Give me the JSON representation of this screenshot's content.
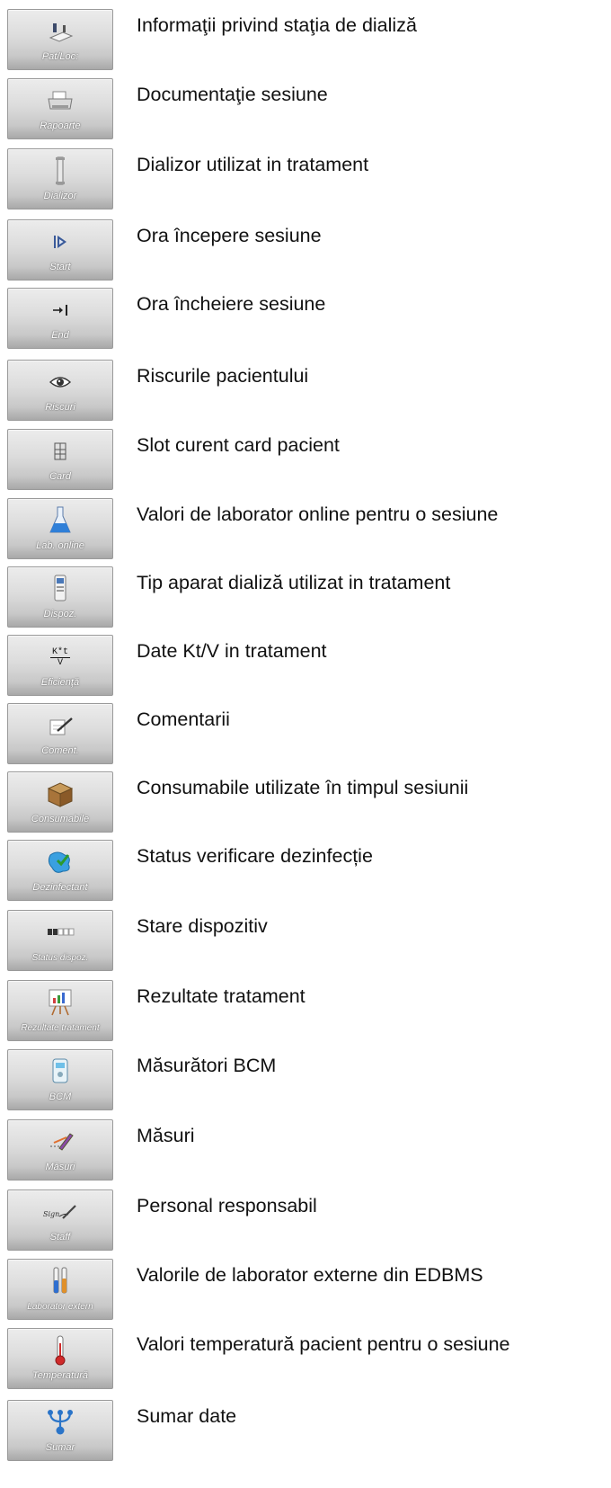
{
  "items": [
    {
      "caption": "Pat/Loc:",
      "icon": "bed-icon",
      "description": "Informaţii privind staţia de dializă"
    },
    {
      "caption": "Rapoarte",
      "icon": "printer-icon",
      "description": "Documentaţie sesiune"
    },
    {
      "caption": "Dializor",
      "icon": "dialyzer-icon",
      "description": " Dializor utilizat in tratament"
    },
    {
      "caption": "Start",
      "icon": "start-icon",
      "description": "Ora începere sesiune"
    },
    {
      "caption": "End",
      "icon": "end-icon",
      "description": "Ora încheiere sesiune"
    },
    {
      "caption": "Riscuri",
      "icon": "eye-icon",
      "description": "Riscurile pacientului"
    },
    {
      "caption": "Card",
      "icon": "card-icon",
      "description": "Slot curent card pacient"
    },
    {
      "caption": "Lab. online",
      "icon": "flask-icon",
      "description": "Valori de laborator online pentru o sesiune"
    },
    {
      "caption": "Dispoz.",
      "icon": "device-icon",
      "description": "Tip aparat dializă utilizat in tratament"
    },
    {
      "caption": "Eficienţă",
      "icon": "ktv-formula-icon",
      "description": "Date Kt/V in tratament"
    },
    {
      "caption": "Coment.",
      "icon": "pen-note-icon",
      "description": "Comentarii"
    },
    {
      "caption": "Consumabile",
      "icon": "box-icon",
      "description": "Consumabile utilizate în timpul sesiunii"
    },
    {
      "caption": "Dezinfectant",
      "icon": "disinfectant-icon",
      "description": "Status verificare dezinfecție"
    },
    {
      "caption": "Status dispoz.",
      "icon": "status-bar-icon",
      "description": "Stare dispozitiv"
    },
    {
      "caption": "Rezultate tratament",
      "icon": "presentation-chart-icon",
      "description": "Rezultate tratament"
    },
    {
      "caption": "BCM",
      "icon": "bcm-device-icon",
      "description": "Măsurători BCM"
    },
    {
      "caption": "Măsuri",
      "icon": "pencil-line-icon",
      "description": "Măsuri"
    },
    {
      "caption": "Staff",
      "icon": "signature-icon",
      "description": "Personal responsabil"
    },
    {
      "caption": "Laborator extern",
      "icon": "test-tubes-icon",
      "description": "Valorile de laborator externe din EDBMS"
    },
    {
      "caption": "Temperatură",
      "icon": "thermometer-icon",
      "description": "Valori temperatură pacient pentru o sesiune"
    },
    {
      "caption": "Sumar",
      "icon": "network-icon",
      "description": "Sumar date"
    }
  ],
  "icon_glyphs": {
    "ktv_numerator": "K*t",
    "ktv_denominator": "V",
    "signature_text": "Sign"
  }
}
